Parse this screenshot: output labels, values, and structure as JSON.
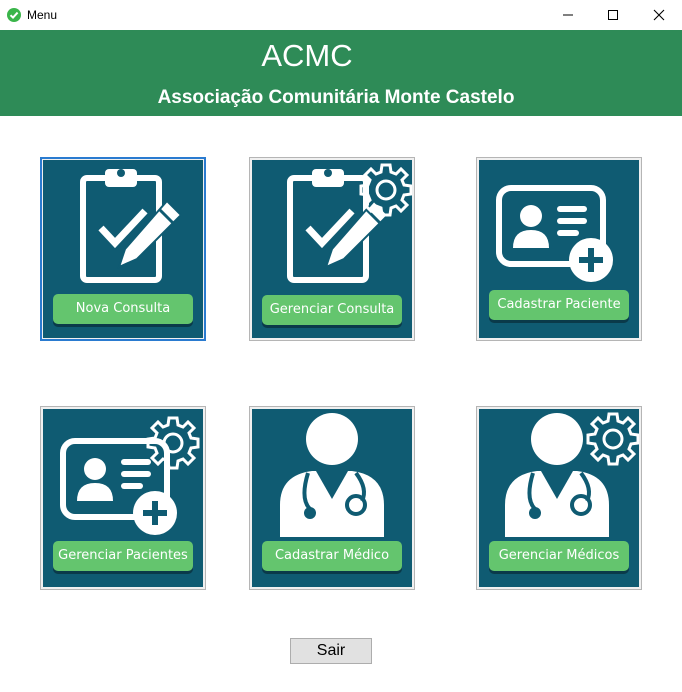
{
  "window": {
    "title": "Menu"
  },
  "header": {
    "title": "ACMC",
    "subtitle": "Associação Comunitária Monte Castelo"
  },
  "tiles": [
    {
      "label": "Nova Consulta",
      "icon": "clipboard-check-pencil-icon"
    },
    {
      "label": "Gerenciar Consulta",
      "icon": "clipboard-check-pencil-gear-icon"
    },
    {
      "label": "Cadastrar Paciente",
      "icon": "patient-card-plus-icon"
    },
    {
      "label": "Gerenciar Pacientes",
      "icon": "patient-card-plus-gear-icon"
    },
    {
      "label": "Cadastrar Médico",
      "icon": "doctor-stethoscope-icon"
    },
    {
      "label": "Gerenciar Médicos",
      "icon": "doctor-stethoscope-gear-icon"
    }
  ],
  "actions": {
    "exit_label": "Sair"
  },
  "colors": {
    "header": "#2e8b57",
    "tile": "#0f5b72",
    "pill": "#64c56e"
  }
}
